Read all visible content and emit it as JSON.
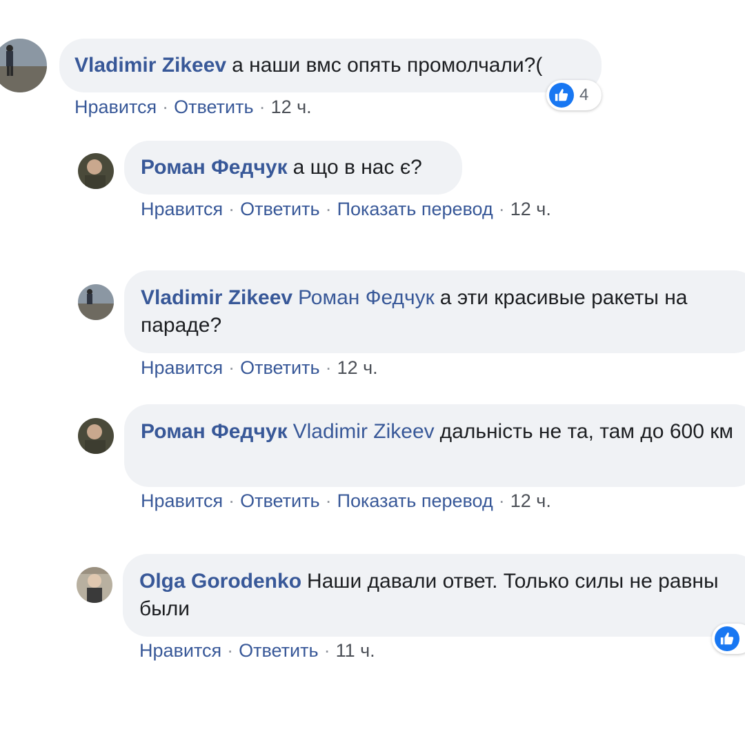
{
  "colors": {
    "bubble": "#f0f2f5",
    "link": "#385898",
    "like_blue": "#1877f2"
  },
  "comments": [
    {
      "author": "Vladimir Zikeev",
      "mention": "",
      "text": "а наши вмс опять промолчали?(",
      "actions": {
        "like": "Нравится",
        "reply": "Ответить",
        "translate": "",
        "time": "12 ч."
      },
      "reactions": {
        "icon": "like-icon",
        "count": "4"
      }
    },
    {
      "author": "Роман Федчук",
      "mention": "",
      "text": "а що в нас є?",
      "actions": {
        "like": "Нравится",
        "reply": "Ответить",
        "translate": "Показать перевод",
        "time": "12 ч."
      }
    },
    {
      "author": "Vladimir Zikeev",
      "mention": "Роман Федчук",
      "text": "а эти красивые ракеты на параде?",
      "actions": {
        "like": "Нравится",
        "reply": "Ответить",
        "translate": "",
        "time": "12 ч."
      }
    },
    {
      "author": "Роман Федчук",
      "mention": "Vladimir Zikeev",
      "text": "дальність не та, там до 600 км",
      "actions": {
        "like": "Нравится",
        "reply": "Ответить",
        "translate": "Показать перевод",
        "time": "12 ч."
      }
    },
    {
      "author": "Olga Gorodenko",
      "mention": "",
      "text": "Наши давали ответ. Только силы не равны были",
      "actions": {
        "like": "Нравится",
        "reply": "Ответить",
        "translate": "",
        "time": "11 ч."
      },
      "reactions": {
        "icon": "like-icon"
      }
    }
  ]
}
